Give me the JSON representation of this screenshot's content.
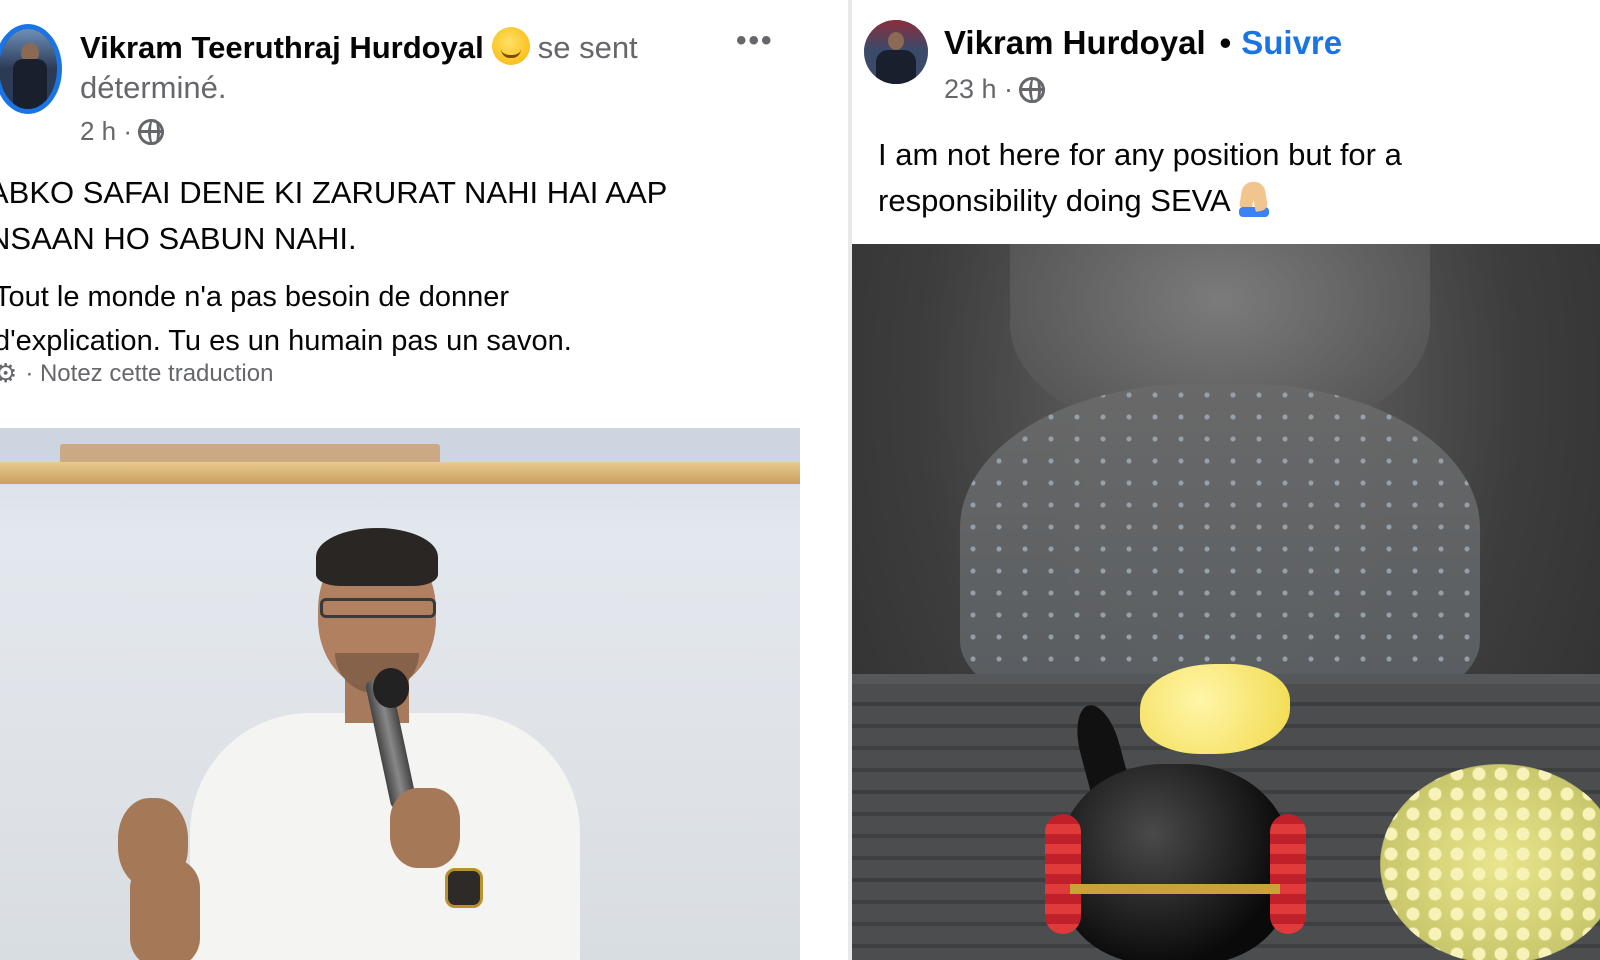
{
  "left_post": {
    "author": "Vikram Teeruthraj Hurdoyal",
    "feeling_prefix": "se sent",
    "feeling": "déterminé.",
    "time": "2 h ·",
    "original_text_line1": "ABKO SAFAI DENE KI ZARURAT NAHI HAI AAP",
    "original_text_line2": "NSAAN HO SABUN NAHI.",
    "translated_text_line1": "Tout le monde n'a pas besoin de donner",
    "translated_text_line2": "d'explication. Tu es un humain pas un savon.",
    "translation_action": "· Notez cette traduction",
    "more_label": "•••",
    "icons": {
      "emoji": "smirking-face-icon",
      "audience": "globe-icon",
      "settings": "gear-icon",
      "more": "more-options-icon"
    }
  },
  "right_post": {
    "author": "Vikram Hurdoyal",
    "separator": "•",
    "follow_label": "Suivre",
    "time": "23 h ·",
    "text_line1": "I am not here for any position but for a",
    "text_line2": "responsibility doing SEVA",
    "icons": {
      "emoji": "folded-hands-icon",
      "audience": "globe-icon"
    }
  },
  "colors": {
    "link_blue": "#1b74e4",
    "meta_gray": "#65676b",
    "text_primary": "#050505"
  }
}
